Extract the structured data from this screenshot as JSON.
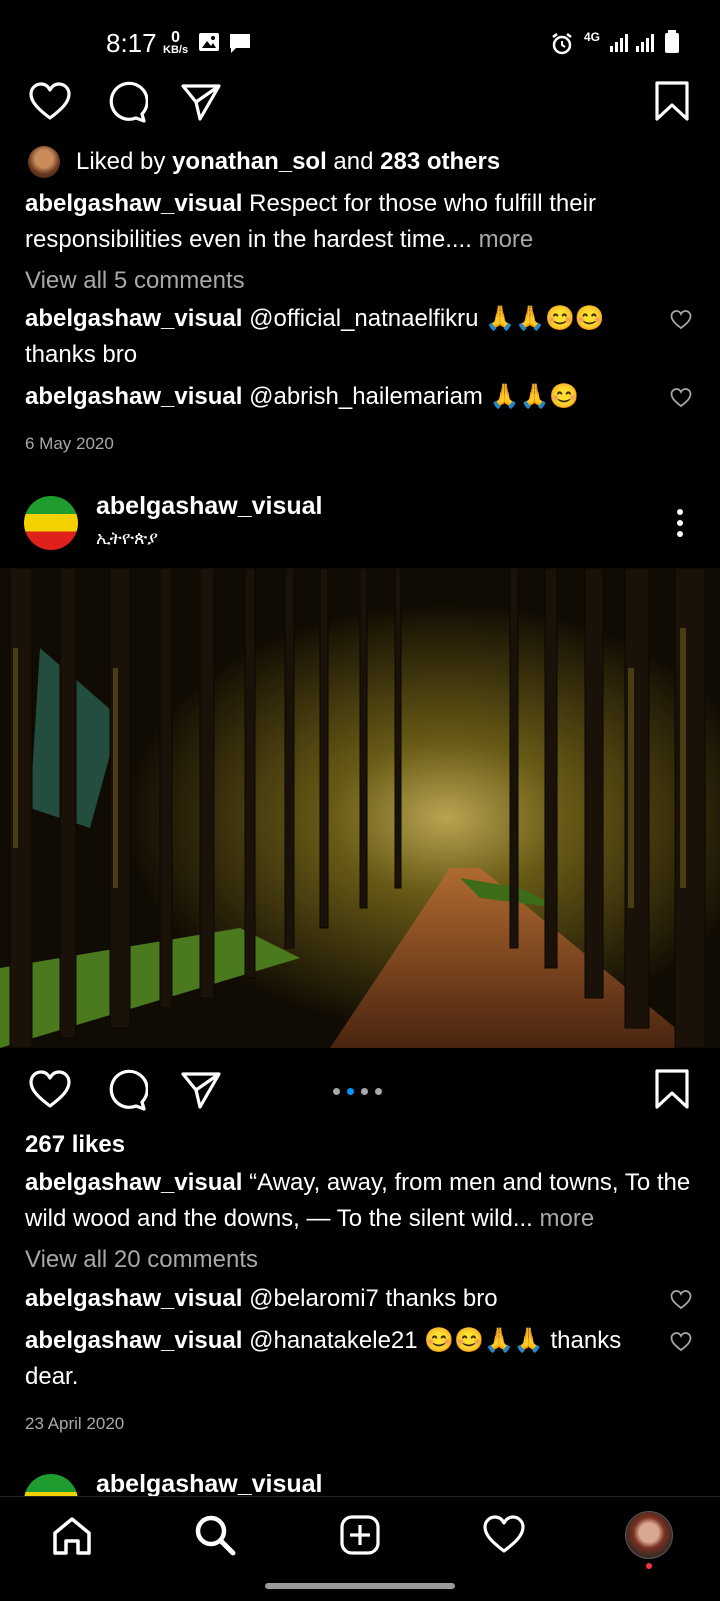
{
  "status": {
    "time": "8:17",
    "net_speed_value": "0",
    "net_speed_unit": "KB/s",
    "network": "4G"
  },
  "post1": {
    "liked_by_prefix": "Liked by ",
    "liked_by_user": "yonathan_sol",
    "liked_by_mid": " and ",
    "liked_by_others": "283 others",
    "caption_user": "abelgashaw_visual",
    "caption_text": " Respect for those who fulfill their responsibilities even in the hardest time....",
    "more_label": " more",
    "view_comments": "View all 5 comments",
    "comments": [
      {
        "user": "abelgashaw_visual",
        "text": " @official_natnaelfikru 🙏🙏😊😊 thanks bro"
      },
      {
        "user": "abelgashaw_visual",
        "text": " @abrish_hailemariam 🙏🙏😊"
      }
    ],
    "date": "6 May 2020"
  },
  "post2": {
    "username": "abelgashaw_visual",
    "location": "ኢትዮጵያ",
    "likes": "267 likes",
    "caption_user": "abelgashaw_visual",
    "caption_text": " “Away, away, from men and towns,  To the wild wood and the downs, —  To the silent wild...",
    "more_label": " more",
    "view_comments": "View all 20 comments",
    "comments": [
      {
        "user": "abelgashaw_visual",
        "text": " @belaromi7 thanks bro"
      },
      {
        "user": "abelgashaw_visual",
        "text": " @hanatakele21 😊😊🙏🙏 thanks dear."
      }
    ],
    "date": "23 April 2020",
    "carousel_count": 4,
    "carousel_active": 1
  },
  "post3": {
    "username": "abelgashaw_visual"
  },
  "colors": {
    "accent": "#0095f6",
    "notification": "#ff3040",
    "secondary_text": "#a8a8a8"
  },
  "icons": [
    "heart-icon",
    "comment-icon",
    "share-icon",
    "bookmark-icon",
    "more-icon",
    "home-icon",
    "search-icon",
    "add-icon",
    "activity-icon",
    "profile-avatar"
  ]
}
